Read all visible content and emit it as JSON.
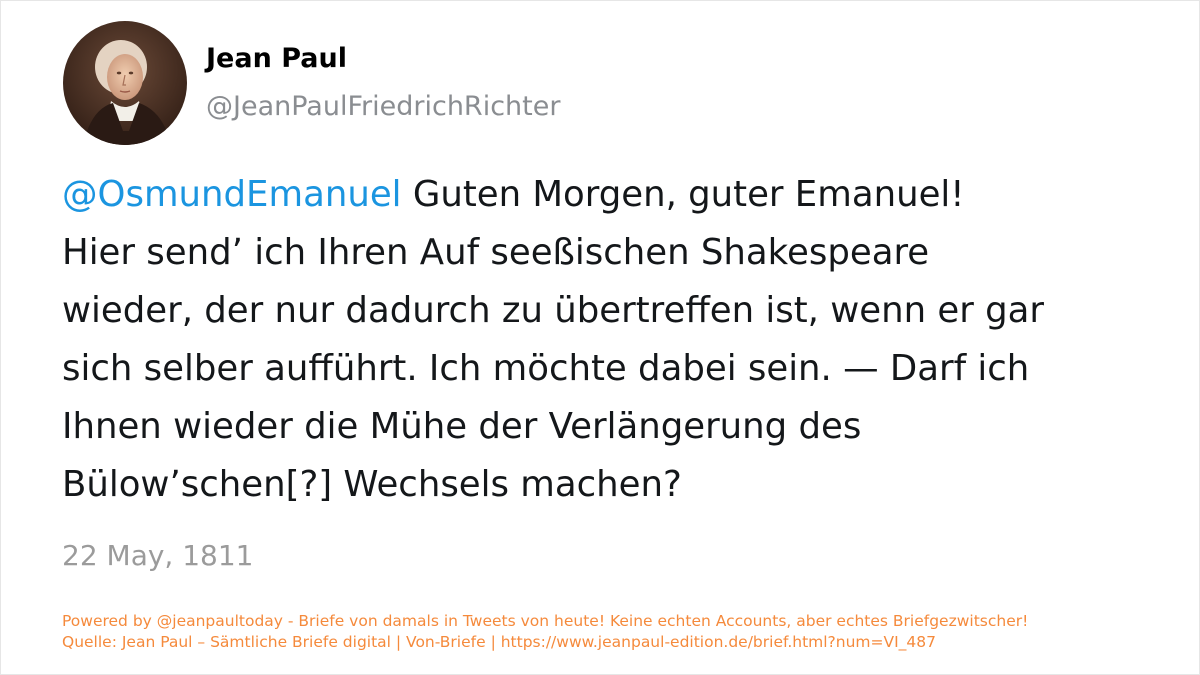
{
  "author": {
    "display_name": "Jean Paul",
    "handle": "@JeanPaulFriedrichRichter",
    "avatar_icon": "portrait-avatar"
  },
  "tweet": {
    "mention": "@OsmundEmanuel",
    "text": " Guten Morgen, guter Emanuel!\nHier send’ ich Ihren Auf seeßischen Shakespeare\nwieder, der nur dadurch zu übertreffen ist, wenn er gar\nsich selber aufführt. Ich möchte dabei sein. — Darf ich\nIhnen wieder die Mühe der Verlängerung des\nBülow’schen[?] Wechsels machen?",
    "date": "22 May, 1811"
  },
  "footer": {
    "line1": "Powered by @jeanpaultoday - Briefe von damals in Tweets von heute! Keine echten Accounts, aber echtes Briefgezwitscher!",
    "line2": "Quelle: Jean Paul – Sämtliche Briefe digital | Von-Briefe | https://www.jeanpaul-edition.de/brief.html?num=VI_487"
  },
  "colors": {
    "mention": "#1b95e0",
    "text": "#14171a",
    "muted": "#8a8d91",
    "footer": "#f58a3c"
  }
}
